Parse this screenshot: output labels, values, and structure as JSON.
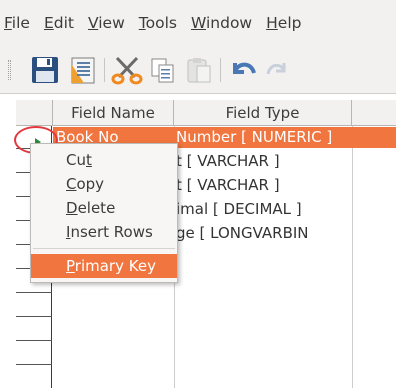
{
  "menubar": {
    "items": [
      {
        "label": "File",
        "mnemonic": "F",
        "rest": "ile"
      },
      {
        "label": "Edit",
        "mnemonic": "E",
        "rest": "dit"
      },
      {
        "label": "View",
        "mnemonic": "V",
        "rest": "iew"
      },
      {
        "label": "Tools",
        "mnemonic": "T",
        "rest": "ools"
      },
      {
        "label": "Window",
        "mnemonic": "W",
        "rest": "indow"
      },
      {
        "label": "Help",
        "mnemonic": "H",
        "rest": "elp"
      }
    ]
  },
  "toolbar": {
    "buttons": [
      "save-icon",
      "form-icon",
      "cut-icon",
      "copy-icon",
      "paste-icon",
      "undo-icon",
      "redo-icon"
    ]
  },
  "table": {
    "headers": [
      "Field Name",
      "Field Type"
    ],
    "rows": [
      {
        "name": "Book No",
        "type": "Number [ NUMERIC ]"
      },
      {
        "name": "",
        "type": "t [ VARCHAR ]"
      },
      {
        "name": "",
        "type": "t [ VARCHAR ]"
      },
      {
        "name": "",
        "type": "imal [ DECIMAL ]"
      },
      {
        "name": "",
        "type": "ge [ LONGVARBIN"
      }
    ]
  },
  "context_menu": {
    "items": [
      {
        "pre": "Cu",
        "mn": "t",
        "post": ""
      },
      {
        "pre": "",
        "mn": "C",
        "post": "opy"
      },
      {
        "pre": "",
        "mn": "D",
        "post": "elete"
      },
      {
        "pre": "",
        "mn": "I",
        "post": "nsert Rows"
      },
      {
        "pre": "",
        "mn": "P",
        "post": "rimary Key"
      }
    ]
  },
  "colors": {
    "accent": "#f0753f",
    "circle": "#e0393e"
  }
}
